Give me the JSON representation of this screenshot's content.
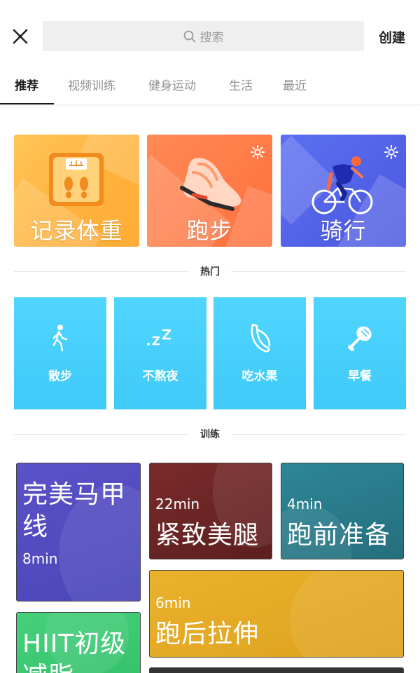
{
  "header": {
    "close_icon": "close-icon",
    "search_placeholder": "搜索",
    "create_label": "创建"
  },
  "tabs": [
    {
      "label": "推荐",
      "active": true
    },
    {
      "label": "视频训练",
      "active": false
    },
    {
      "label": "健身运动",
      "active": false
    },
    {
      "label": "生活",
      "active": false
    },
    {
      "label": "最近",
      "active": false
    }
  ],
  "categories": [
    {
      "label": "记录体重",
      "icon": "scale-icon",
      "color": "#ffb23d"
    },
    {
      "label": "跑步",
      "icon": "running-shoe-icon",
      "color": "#ff6f3c",
      "settings_icon": "gear-icon"
    },
    {
      "label": "骑行",
      "icon": "cyclist-icon",
      "color": "#4a58e0",
      "settings_icon": "gear-icon"
    }
  ],
  "hot_section": {
    "title": "热门",
    "items": [
      {
        "label": "散步",
        "icon": "walking-icon"
      },
      {
        "label": "不熬夜",
        "icon": "sleep-zzz-icon"
      },
      {
        "label": "吃水果",
        "icon": "banana-icon"
      },
      {
        "label": "早餐",
        "icon": "drumstick-icon"
      }
    ],
    "color": "#3fcaf8"
  },
  "training_section": {
    "title": "训练",
    "items": [
      {
        "title": "完美马甲线",
        "duration": "8min"
      },
      {
        "title": "紧致美腿",
        "duration": "22min"
      },
      {
        "title": "跑前准备",
        "duration": "4min"
      },
      {
        "title": "跑后拉伸",
        "duration": "6min"
      },
      {
        "title": "HIIT初级减脂",
        "duration": ""
      }
    ]
  }
}
